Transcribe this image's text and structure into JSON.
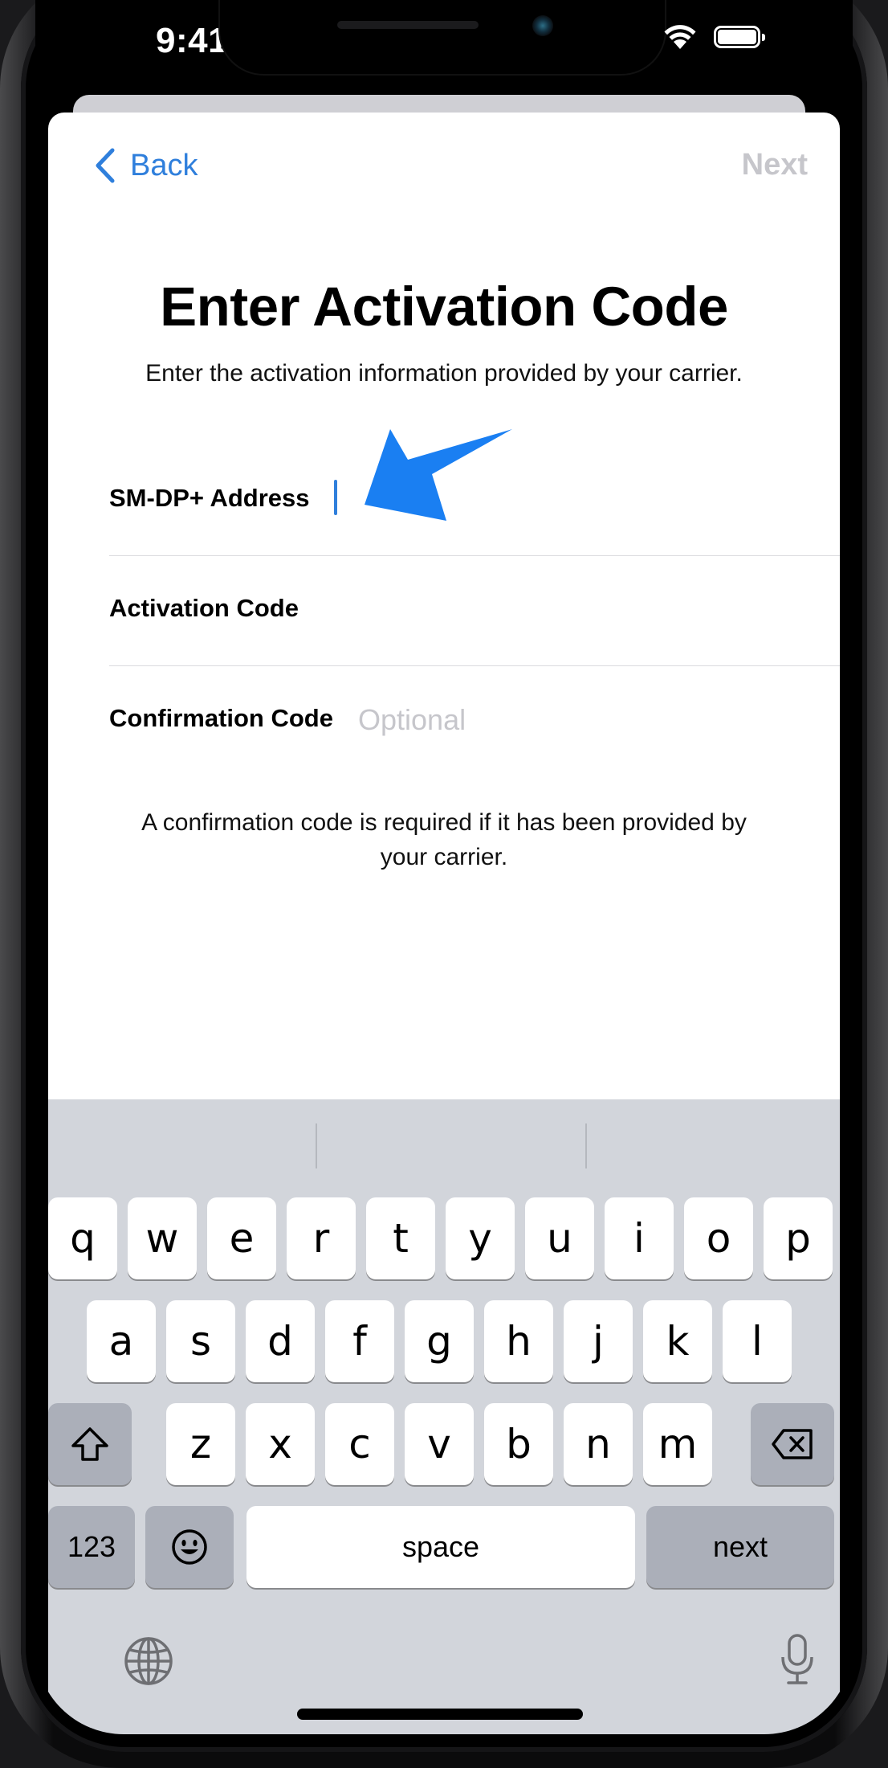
{
  "status_bar": {
    "time": "9:41"
  },
  "nav": {
    "back_label": "Back",
    "next_label": "Next"
  },
  "header": {
    "title": "Enter Activation Code",
    "subtitle": "Enter the activation information provided by your carrier."
  },
  "form": {
    "fields": [
      {
        "label": "SM-DP+ Address",
        "value": "",
        "placeholder": ""
      },
      {
        "label": "Activation Code",
        "value": "",
        "placeholder": ""
      },
      {
        "label": "Confirmation Code",
        "value": "",
        "placeholder": "Optional"
      }
    ],
    "note": "A confirmation code is required if it has been provided by your carrier."
  },
  "annotation": {
    "arrow_icon": "arrow-pointer-icon",
    "color": "#1a7ff2"
  },
  "keyboard": {
    "row1": [
      "q",
      "w",
      "e",
      "r",
      "t",
      "y",
      "u",
      "i",
      "o",
      "p"
    ],
    "row2": [
      "a",
      "s",
      "d",
      "f",
      "g",
      "h",
      "j",
      "k",
      "l"
    ],
    "row3": [
      "z",
      "x",
      "c",
      "v",
      "b",
      "n",
      "m"
    ],
    "numbers_label": "123",
    "space_label": "space",
    "return_label": "next",
    "icons": [
      "shift-icon",
      "delete-icon",
      "emoji-icon",
      "globe-icon",
      "microphone-icon"
    ]
  },
  "colors": {
    "accent": "#2f7fdc",
    "disabled": "#c6c6cb",
    "keyboard_bg": "#d2d5db",
    "key_dark": "#abafb9"
  }
}
